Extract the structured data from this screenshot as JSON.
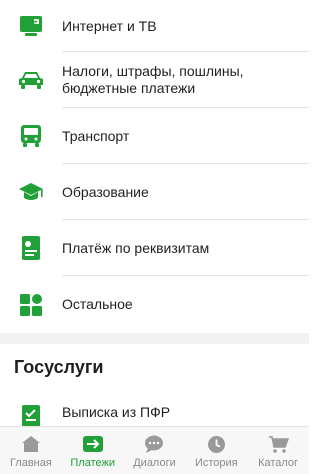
{
  "list": {
    "items": [
      {
        "label": "Интернет и ТВ",
        "icon": "tv-icon"
      },
      {
        "label": "Налоги, штрафы, пошлины, бюджетные платежи",
        "icon": "car-icon"
      },
      {
        "label": "Транспорт",
        "icon": "bus-icon"
      },
      {
        "label": "Образование",
        "icon": "graduation-cap-icon"
      },
      {
        "label": "Платёж по реквизитам",
        "icon": "requisites-card-icon"
      },
      {
        "label": "Остальное",
        "icon": "grid-icon"
      }
    ]
  },
  "gosuslugi": {
    "title": "Госуслуги",
    "items": [
      {
        "label": "Выписка из ПФР",
        "icon": "document-icon"
      }
    ]
  },
  "tabbar": {
    "tabs": [
      {
        "label": "Главная",
        "icon": "home-icon",
        "active": false
      },
      {
        "label": "Платежи",
        "icon": "payments-arrow-icon",
        "active": true
      },
      {
        "label": "Диалоги",
        "icon": "chat-icon",
        "active": false
      },
      {
        "label": "История",
        "icon": "clock-icon",
        "active": false
      },
      {
        "label": "Каталог",
        "icon": "cart-icon",
        "active": false
      }
    ]
  },
  "colors": {
    "accent": "#21a038",
    "inactive": "#9a9a9a",
    "text": "#1f1f1f",
    "divider": "#e4e4e4"
  }
}
